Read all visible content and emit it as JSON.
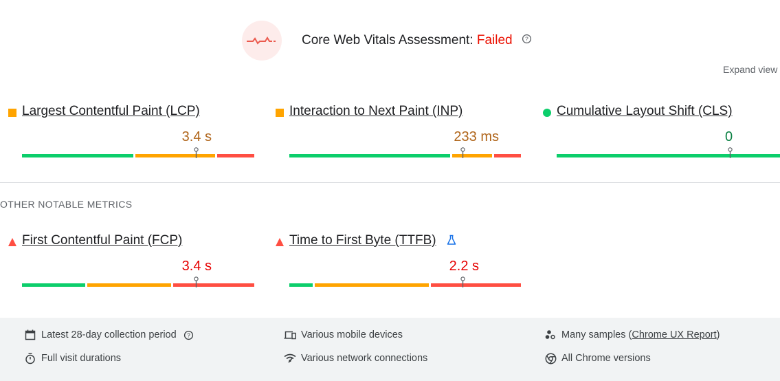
{
  "assessment": {
    "title": "Core Web Vitals Assessment:",
    "status": "Failed",
    "status_color": "#eb0f00"
  },
  "expand_view": "Expand view",
  "colors": {
    "good": "#0cce6b",
    "needs_improvement": "#ffa400",
    "poor": "#ff4e42",
    "needs_improvement_text": "#b0651a",
    "good_text": "#0a8043",
    "poor_text": "#e60000"
  },
  "core_metrics": [
    {
      "name": "Largest Contentful Paint (LCP)",
      "value": "3.4 s",
      "rating": "needs-improvement",
      "indicator": "orange-square-icon",
      "distribution": [
        0.48,
        0.35,
        0.17
      ],
      "marker_fraction": 0.75
    },
    {
      "name": "Interaction to Next Paint (INP)",
      "value": "233 ms",
      "rating": "needs-improvement",
      "indicator": "orange-square-icon",
      "distribution": [
        0.7,
        0.18,
        0.12
      ],
      "marker_fraction": 0.75
    },
    {
      "name": "Cumulative Layout Shift (CLS)",
      "value": "0",
      "rating": "good",
      "indicator": "green-circle-icon",
      "distribution": [
        1.0,
        0,
        0
      ],
      "marker_fraction": 0.75
    }
  ],
  "other_label": "OTHER NOTABLE METRICS",
  "other_metrics": [
    {
      "name": "First Contentful Paint (FCP)",
      "value": "3.4 s",
      "rating": "poor",
      "indicator": "red-triangle-icon",
      "distribution": [
        0.275,
        0.37,
        0.355
      ],
      "marker_fraction": 0.75
    },
    {
      "name": "Time to First Byte (TTFB)",
      "value": "2.2 s",
      "rating": "poor",
      "indicator": "red-triangle-icon",
      "experimental_icon": "flask-icon",
      "distribution": [
        0.105,
        0.495,
        0.4
      ],
      "marker_fraction": 0.75
    }
  ],
  "footer": {
    "collection_period": "Latest 28-day collection period",
    "devices": "Various mobile devices",
    "samples_prefix": "Many samples (",
    "samples_link": "Chrome UX Report",
    "samples_suffix": ")",
    "visit_durations": "Full visit durations",
    "network": "Various network connections",
    "chrome_versions": "All Chrome versions"
  }
}
